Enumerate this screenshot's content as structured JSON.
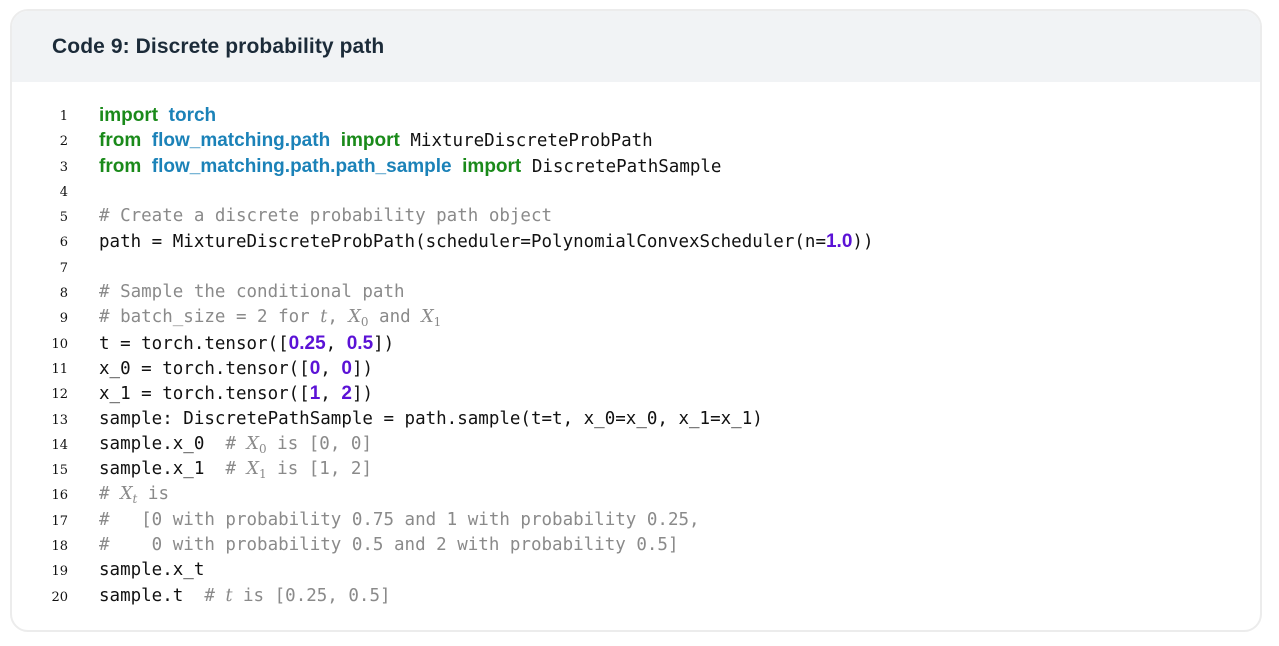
{
  "title": "Code 9: Discrete probability path",
  "lines": [
    {
      "n": "1"
    },
    {
      "n": "2"
    },
    {
      "n": "3"
    },
    {
      "n": "4"
    },
    {
      "n": "5"
    },
    {
      "n": "6"
    },
    {
      "n": "7"
    },
    {
      "n": "8"
    },
    {
      "n": "9"
    },
    {
      "n": "10"
    },
    {
      "n": "11"
    },
    {
      "n": "12"
    },
    {
      "n": "13"
    },
    {
      "n": "14"
    },
    {
      "n": "15"
    },
    {
      "n": "16"
    },
    {
      "n": "17"
    },
    {
      "n": "18"
    },
    {
      "n": "19"
    },
    {
      "n": "20"
    }
  ],
  "code": {
    "l1_kw": "import",
    "l1_mod": "torch",
    "l2_kw1": "from",
    "l2_mod": "flow_matching.path",
    "l2_kw2": "import",
    "l2_name": "MixtureDiscreteProbPath",
    "l3_kw1": "from",
    "l3_mod": "flow_matching.path.path_sample",
    "l3_kw2": "import",
    "l3_name": "DiscretePathSample",
    "l5_comment": "# Create a discrete probability path object",
    "l6_pre": "path = MixtureDiscreteProbPath(scheduler=PolynomialConvexScheduler(n=",
    "l6_num": "1.0",
    "l6_post": "))",
    "l8_comment": "# Sample the conditional path",
    "l9_pre": "# batch_size = 2 for ",
    "l9_t": "t",
    "l9_comma": ", ",
    "l9_X": "X",
    "l9_sub0": "0",
    "l9_and": " and ",
    "l9_X2": "X",
    "l9_sub1": "1",
    "l10_pre": "t = torch.tensor([",
    "l10_n1": "0.25",
    "l10_mid": ", ",
    "l10_n2": "0.5",
    "l10_post": "])",
    "l11_pre": "x_0 = torch.tensor([",
    "l11_n1": "0",
    "l11_mid": ", ",
    "l11_n2": "0",
    "l11_post": "])",
    "l12_pre": "x_1 = torch.tensor([",
    "l12_n1": "1",
    "l12_mid": ", ",
    "l12_n2": "2",
    "l12_post": "])",
    "l13": "sample: DiscretePathSample = path.sample(t=t, x_0=x_0, x_1=x_1)",
    "l14_code": "sample.x_0  ",
    "l14_hash": "# ",
    "l14_X": "X",
    "l14_sub": "0",
    "l14_rest": " is [0, 0]",
    "l15_code": "sample.x_1  ",
    "l15_hash": "# ",
    "l15_X": "X",
    "l15_sub": "1",
    "l15_rest": " is [1, 2]",
    "l16_hash": "# ",
    "l16_X": "X",
    "l16_sub": "t",
    "l16_rest": " is",
    "l17": "#   [0 with probability 0.75 and 1 with probability 0.25,",
    "l18": "#    0 with probability 0.5 and 2 with probability 0.5]",
    "l19": "sample.x_t",
    "l20_code": "sample.t  ",
    "l20_hash": "# ",
    "l20_t": "t",
    "l20_rest": " is [0.25, 0.5]"
  }
}
